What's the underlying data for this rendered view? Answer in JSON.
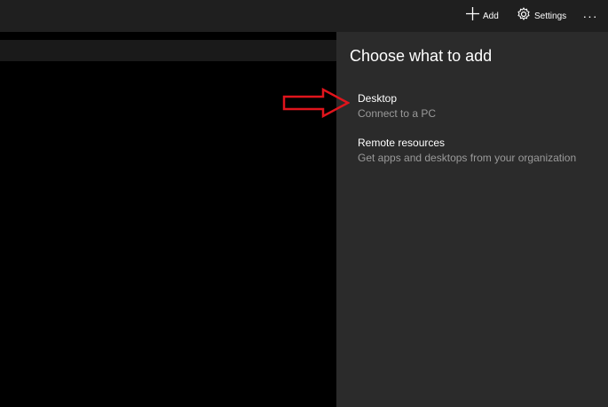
{
  "toolbar": {
    "add_label": "Add",
    "add_icon": "plus-icon",
    "settings_label": "Settings",
    "settings_icon": "gear-icon",
    "more_label": "···"
  },
  "panel": {
    "title": "Choose what to add",
    "options": [
      {
        "title": "Desktop",
        "subtitle": "Connect to a PC"
      },
      {
        "title": "Remote resources",
        "subtitle": "Get apps and desktops from your organization"
      }
    ]
  },
  "annotation": {
    "icon": "arrow-right-icon",
    "color": "#e0141c"
  }
}
